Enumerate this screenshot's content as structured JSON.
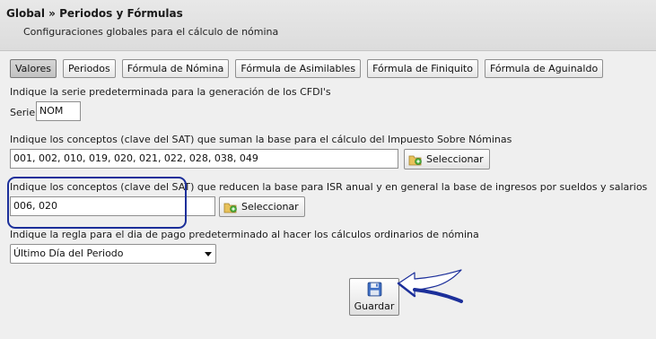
{
  "header": {
    "title": "Global » Periodos y Fórmulas",
    "subtitle": "Configuraciones globales para el cálculo de nómina"
  },
  "tabs": [
    {
      "label": "Valores",
      "active": true
    },
    {
      "label": "Periodos"
    },
    {
      "label": "Fórmula de Nómina"
    },
    {
      "label": "Fórmula de Asimilables"
    },
    {
      "label": "Fórmula de Finiquito"
    },
    {
      "label": "Fórmula de Aguinaldo"
    }
  ],
  "serie": {
    "description": "Indique la serie predeterminada para la generación de los CFDI's",
    "label": "Serie",
    "value": "NOM"
  },
  "isn": {
    "description": "Indique los conceptos (clave del SAT) que suman la base para el cálculo del Impuesto Sobre Nóminas",
    "value": "001, 002, 010, 019, 020, 021, 022, 028, 038, 049",
    "button_label": "Seleccionar"
  },
  "isr": {
    "description": "Indique los conceptos (clave del SAT) que reducen la base para ISR anual y en general la base de ingresos por sueldos y salarios",
    "value": "006, 020",
    "button_label": "Seleccionar"
  },
  "pago": {
    "description": "Indique la regla para el dia de pago predeterminado al hacer los cálculos ordinarios de nómina",
    "selected": "Último Día del Periodo"
  },
  "save": {
    "label": "Guardar"
  },
  "colors": {
    "annotation": "#1c2f9a"
  }
}
